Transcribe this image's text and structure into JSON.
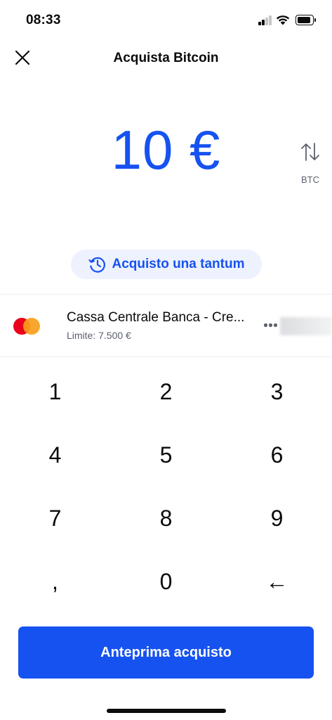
{
  "status_bar": {
    "time": "08:33"
  },
  "header": {
    "title": "Acquista Bitcoin",
    "close_icon": "close-icon"
  },
  "amount": {
    "display": "10 €",
    "swap_currency": "BTC",
    "swap_icon": "swap-arrows-icon"
  },
  "frequency": {
    "label": "Acquisto una tantum",
    "icon": "clock-repeat-icon"
  },
  "payment_method": {
    "name": "Cassa Centrale Banca - Cre...",
    "limit": "Limite: 7.500 €",
    "logo": "mastercard-icon",
    "more_icon": "more-horizontal-icon"
  },
  "keypad": {
    "keys": [
      "1",
      "2",
      "3",
      "4",
      "5",
      "6",
      "7",
      "8",
      "9",
      ",",
      "0",
      "←"
    ]
  },
  "primary_button": {
    "label": "Anteprima acquisto"
  },
  "colors": {
    "accent": "#1652f0",
    "pill_background": "#eef2fe",
    "text_primary": "#0a0b0d",
    "text_secondary": "#5b616e",
    "mastercard_red": "#eb001b",
    "mastercard_orange": "#f79e1b"
  }
}
